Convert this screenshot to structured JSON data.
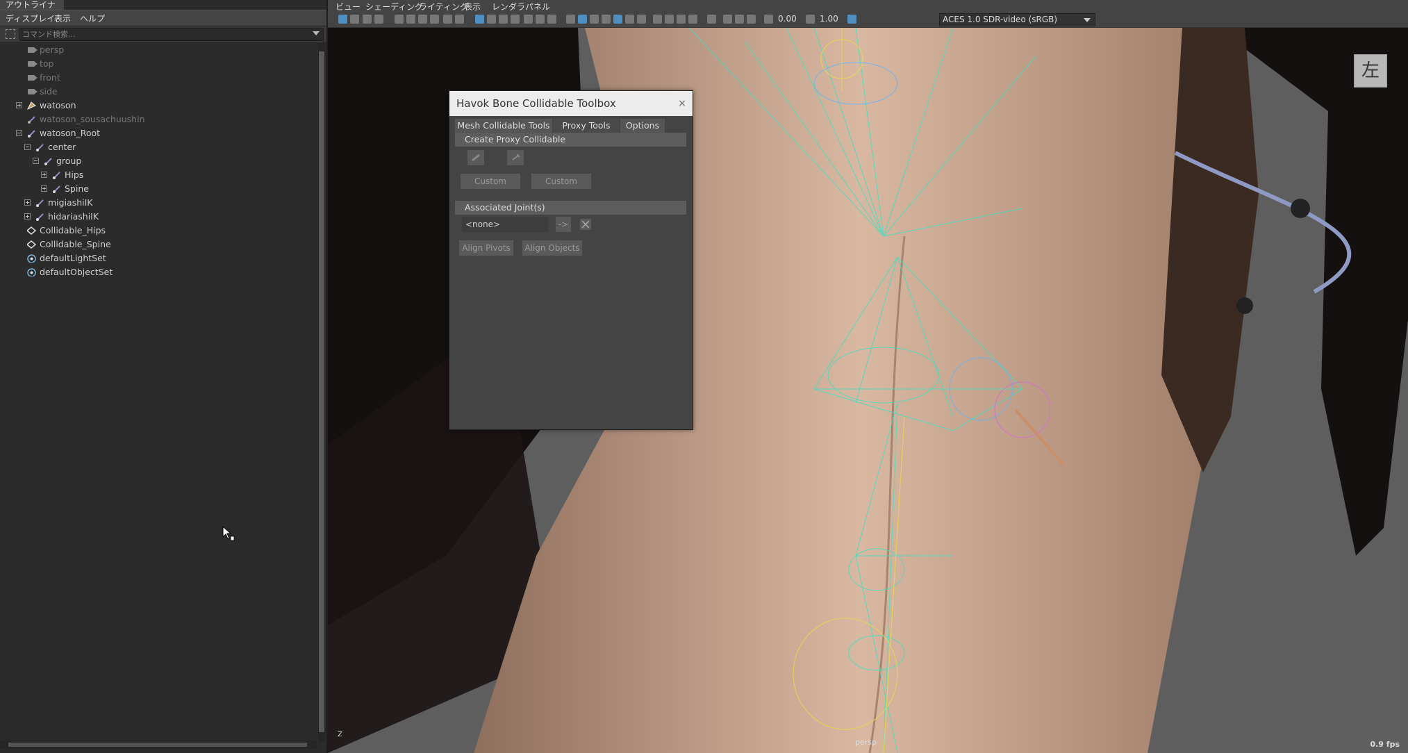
{
  "outliner": {
    "tab_label": "アウトライナ",
    "menu": [
      "ディスプレイ",
      "表示",
      "ヘルプ"
    ],
    "search_placeholder": "コマンド検索...",
    "items": [
      {
        "label": "persp",
        "icon": "camera-icon",
        "dim": true
      },
      {
        "label": "top",
        "icon": "camera-icon",
        "dim": true
      },
      {
        "label": "front",
        "icon": "camera-icon",
        "dim": true
      },
      {
        "label": "side",
        "icon": "camera-icon",
        "dim": true
      },
      {
        "label": "watoson",
        "icon": "mesh-icon",
        "expander": "plus"
      },
      {
        "label": "watoson_sousachuushin",
        "icon": "joint-icon",
        "dim": true
      },
      {
        "label": "watoson_Root",
        "icon": "joint-icon",
        "expander": "minus"
      },
      {
        "label": "center",
        "icon": "joint-icon",
        "expander": "minus"
      },
      {
        "label": "group",
        "icon": "joint-icon",
        "expander": "minus"
      },
      {
        "label": "Hips",
        "icon": "joint-icon",
        "expander": "plus"
      },
      {
        "label": "Spine",
        "icon": "joint-icon",
        "expander": "plus"
      },
      {
        "label": "migiashiIK",
        "icon": "joint-icon",
        "expander": "plus"
      },
      {
        "label": "hidariashiIK",
        "icon": "joint-icon",
        "expander": "plus"
      },
      {
        "label": "Collidable_Hips",
        "icon": "collidable-icon"
      },
      {
        "label": "Collidable_Spine",
        "icon": "collidable-icon"
      },
      {
        "label": "defaultLightSet",
        "icon": "set-icon"
      },
      {
        "label": "defaultObjectSet",
        "icon": "set-icon"
      }
    ]
  },
  "viewport": {
    "menu": [
      "ビュー",
      "シェーディング",
      "ライティング",
      "表示",
      "レンダラ",
      "パネル"
    ],
    "field1_value": "0.00",
    "field2_value": "1.00",
    "color_space": "ACES 1.0 SDR-video (sRGB)",
    "view_cube_label": "左",
    "camera_label": "persp",
    "fps": "0.9 fps",
    "axis_label": "Z"
  },
  "dialog": {
    "title": "Havok Bone Collidable Toolbox",
    "close": "×",
    "tabs": [
      "Mesh Collidable Tools",
      "Proxy Tools",
      "Options"
    ],
    "section1": "Create Proxy Collidable",
    "custom1": "Custom",
    "custom2": "Custom",
    "section2": "Associated Joint(s)",
    "joint_value": "<none>",
    "arrow": "->",
    "align_pivots": "Align Pivots",
    "align_objects": "Align Objects"
  }
}
